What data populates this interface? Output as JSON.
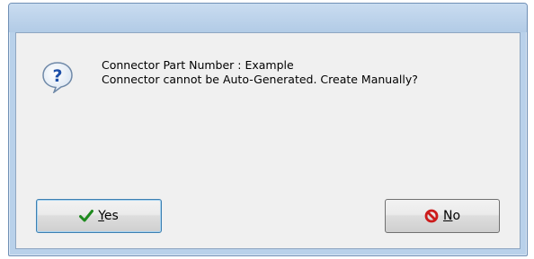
{
  "dialog": {
    "message_line1": "Connector Part Number : Example",
    "message_line2": "Connector cannot be Auto-Generated. Create Manually?",
    "icon": "question-icon"
  },
  "buttons": {
    "yes": {
      "mnemonic": "Y",
      "rest": "es",
      "icon": "check-icon"
    },
    "no": {
      "mnemonic": "N",
      "rest": "o",
      "icon": "no-entry-icon"
    }
  },
  "colors": {
    "frame": "#b9d1ea",
    "client": "#f0f0f0",
    "check_green": "#1e8a1e",
    "no_red": "#cc1b1b",
    "focus_border": "#3c7fb1"
  }
}
